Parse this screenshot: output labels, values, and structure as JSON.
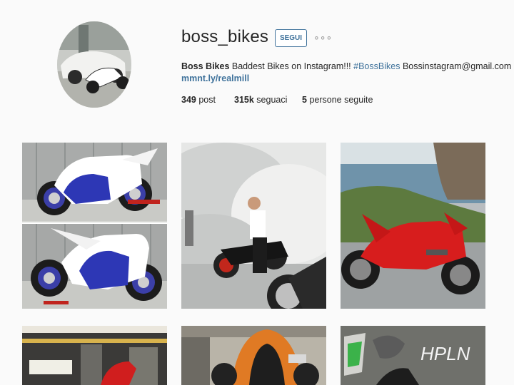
{
  "profile": {
    "username": "boss_bikes",
    "follow_label": "SEGUI",
    "more_label": "∘∘∘",
    "bio": {
      "name": "Boss Bikes",
      "text": "Baddest Bikes on Instagram!!!",
      "hashtag": "#BossBikes",
      "email": "Bossinstagram@gmail.com"
    },
    "link": "mmnt.ly/realmill",
    "stats": [
      {
        "count": "349",
        "label": "post"
      },
      {
        "count": "315k",
        "label": "seguaci"
      },
      {
        "count": "5",
        "label": "persone seguite"
      }
    ]
  },
  "posts": [
    {
      "subject": "blue-white-yamaha-superbike-duo"
    },
    {
      "subject": "man-on-black-cruiser-burnout-smoke"
    },
    {
      "subject": "red-ducati-panigale-coast"
    },
    {
      "subject": "red-bike-shop-street"
    },
    {
      "subject": "orange-superbike-rear-street"
    },
    {
      "subject": "bike-graffiti-wall"
    }
  ],
  "colors": {
    "accent": "#3f729b",
    "text": "#262626",
    "background": "#fafafa"
  }
}
